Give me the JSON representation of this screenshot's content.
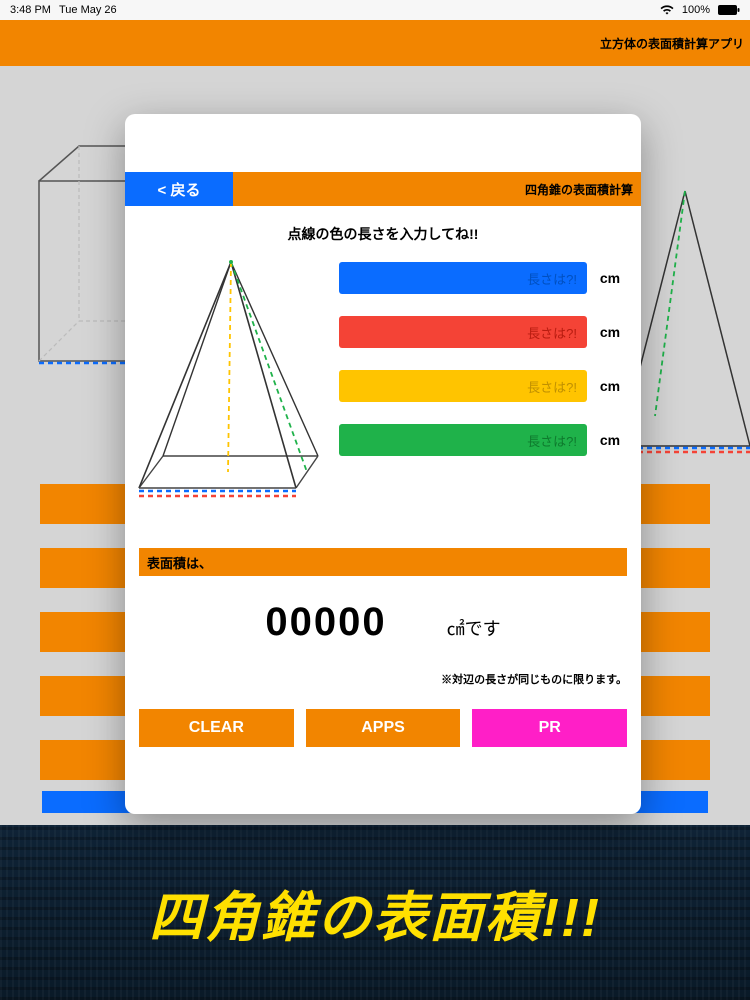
{
  "status": {
    "time": "3:48 PM",
    "date": "Tue May 26",
    "battery": "100%"
  },
  "bg_header": {
    "title": "立方体の表面積計算アプリ"
  },
  "modal": {
    "back": "< 戻る",
    "title": "四角錐の表面積計算",
    "instruction": "点線の色の長さを入力してね!!",
    "inputs": {
      "blue": {
        "placeholder": "長さは?!"
      },
      "red": {
        "placeholder": "長さは?!"
      },
      "yellow": {
        "placeholder": "長さは?!"
      },
      "green": {
        "placeholder": "長さは?!"
      }
    },
    "unit": "cm",
    "result_label": "表面積は、",
    "result_value": "00000",
    "result_unit": "㎠です",
    "note": "※対辺の長さが同じものに限ります。",
    "buttons": {
      "clear": "CLEAR",
      "apps": "APPS",
      "pr": "PR"
    }
  },
  "footer": {
    "text": "四角錐の表面積!!!"
  },
  "colors": {
    "orange": "#f28500",
    "blue": "#0a6cff",
    "red": "#f44336",
    "yellow": "#ffc400",
    "green": "#1fb24a",
    "pink": "#ff1fc7"
  }
}
